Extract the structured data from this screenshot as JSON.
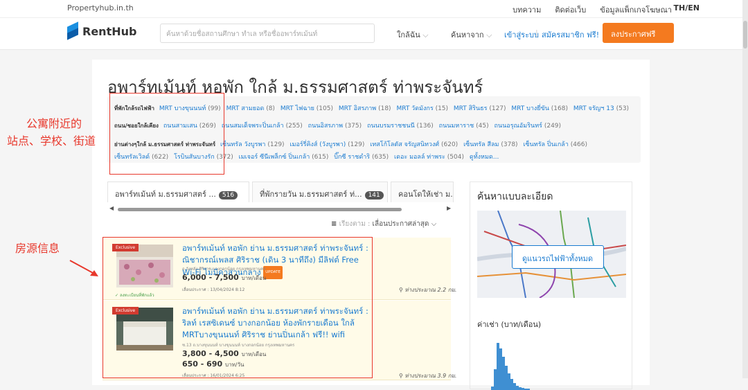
{
  "topbar": {
    "site": "Propertyhub.in.th",
    "links": [
      "บทความ",
      "ติดต่อเว็บ",
      "ข้อมูลแพ็กเกจโฆษณา"
    ],
    "lang": "TH/EN"
  },
  "nav": {
    "brand": "RentHub",
    "search_placeholder": "ค้นหาด้วยชื่อสถานศึกษา ทำเล หรือชื่ออพาร์ทเม้นท์",
    "near": "ใกล้ฉัน",
    "search_from": "ค้นหาจาก",
    "login": "เข้าสู่ระบบ",
    "register": "สมัครสมาชิก ฟรี!",
    "post": "ลงประกาศฟรี"
  },
  "page": {
    "title": "อพาร์ทเม้นท์ หอพัก ใกล้ ม.ธรรมศาสตร์ ท่าพระจันทร์"
  },
  "tags": {
    "rows": [
      {
        "label": "ที่พักใกล้รถไฟฟ้า",
        "items": [
          {
            "name": "MRT บางขุนนนท์",
            "count": "(99)"
          },
          {
            "name": "MRT สามยอด",
            "count": "(8)"
          },
          {
            "name": "MRT ไฟฉาย",
            "count": "(105)"
          },
          {
            "name": "MRT อิสรภาพ",
            "count": "(18)"
          },
          {
            "name": "MRT วัดมังกร",
            "count": "(15)"
          },
          {
            "name": "MRT สิรินธร",
            "count": "(127)"
          },
          {
            "name": "MRT บางยี่ขัน",
            "count": "(168)"
          },
          {
            "name": "MRT จรัญฯ 13",
            "count": "(53)"
          }
        ]
      },
      {
        "label": "ถนน/ซอยใกล้เคียง",
        "items": [
          {
            "name": "ถนนสามเสน",
            "count": "(269)"
          },
          {
            "name": "ถนนสมเด็จพระปิ่นเกล้า",
            "count": "(255)"
          },
          {
            "name": "ถนนอิสรภาพ",
            "count": "(375)"
          },
          {
            "name": "ถนนบรมราชชนนี",
            "count": "(136)"
          },
          {
            "name": "ถนนมหาราช",
            "count": "(45)"
          },
          {
            "name": "ถนนอรุณอัมรินทร์",
            "count": "(249)"
          }
        ]
      },
      {
        "label": "ย่านต่างๆใกล้ ม.ธรรมศาสตร์ ท่าพระจันทร์",
        "items": [
          {
            "name": "เซ็นทรัล วังบูรพา",
            "count": "(129)"
          },
          {
            "name": "เมอร์รี่คิงส์ (วังบูรพา)",
            "count": "(129)"
          },
          {
            "name": "เทสโก้โลตัส จรัญสนิทวงศ์",
            "count": "(620)"
          },
          {
            "name": "เซ็นทรัล สีลม",
            "count": "(378)"
          },
          {
            "name": "เซ็นทรัล ปิ่นเกล้า",
            "count": "(466)"
          }
        ]
      },
      {
        "label": "",
        "items": [
          {
            "name": "เซ็นทรัลเวิลด์",
            "count": "(622)"
          },
          {
            "name": "โรบินสันบางรัก",
            "count": "(372)"
          },
          {
            "name": "เมเจอร์ ซีนีเพล็กซ์ ปิ่นเกล้า",
            "count": "(615)"
          },
          {
            "name": "บิ๊กซี ราชดำริ",
            "count": "(635)"
          },
          {
            "name": "เดอะ มอลล์ ท่าพระ",
            "count": "(504)"
          },
          {
            "name": "ดูทั้งหมด...",
            "count": ""
          }
        ]
      }
    ]
  },
  "tabs": [
    {
      "label": "อพาร์ทเม้นท์ ม.ธรรมศาสตร์ ...",
      "count": "516"
    },
    {
      "label": "ที่พักรายวัน ม.ธรรมศาสตร์ ท่...",
      "count": "141"
    },
    {
      "label": "คอนโดให้เช่า ม.",
      "count": ""
    }
  ],
  "sort": {
    "label": "เรียงตาม :",
    "value": "เลื่อนประกาศล่าสุด"
  },
  "listings": [
    {
      "badge": "Exclusive",
      "title": "อพาร์ทเม้นท์ หอพัก ย่าน ม.ธรรมศาสตร์ ท่าพระจันทร์ : ณิชากรณ์เพลส ศิริราช (เดิน 3 นาทีถึง) มีลิฟต์ Free Wi-Fi ไม่มีค่าส่วนกลาง",
      "update": "UPDATE",
      "address": "ถ.วังหลัง ศิริราช บางกอกน้อย กรุงเทพมหานคร",
      "prices": [
        {
          "amount": "6,000 - 7,500",
          "unit": "บาท/เดือน"
        }
      ],
      "date": "เลื่อนประกาศ : 13/04/2024 8:12",
      "distance": "ห่างประมาณ 2.2 กม.",
      "verify": "ลงทะเบียนที่พักแล้ว"
    },
    {
      "badge": "Exclusive",
      "title": "อพาร์ทเม้นท์ หอพัก ย่าน ม.ธรรมศาสตร์ ท่าพระจันทร์ : ริลท์ เรสซิเดนซ์ บางกอกน้อย ห้องพักรายเดือน ใกล้ MRTบางขุนนนท์ ศิริราช ย่านปิ่นเกล้า ฟรี!! wifi",
      "update": "",
      "address": "ซ.13 ถ.บางขุนนนท์ บางขุนนนท์ บางกอกน้อย กรุงเทพมหานคร",
      "prices": [
        {
          "amount": "3,800 - 4,500",
          "unit": "บาท/เดือน"
        },
        {
          "amount": "650 - 690",
          "unit": "บาท/วัน"
        }
      ],
      "date": "เลื่อนประกาศ : 16/01/2024 6:25",
      "distance": "ห่างประมาณ 3.9 กม.",
      "verify": ""
    }
  ],
  "sidebar": {
    "heading": "ค้นหาแบบละเอียด",
    "map_button": "ดูแนวรถไฟฟ้าทั้งหมด",
    "price_heading": "ค่าเช่า (บาท/เดือน)"
  },
  "annotations": {
    "tags_note_line1": "公寓附近的",
    "tags_note_line2": "站点、学校、街道",
    "listing_note": "房源信息"
  },
  "colors": {
    "accent": "#f47a1f",
    "link": "#1a7bd0",
    "annotation": "#e8382c"
  }
}
